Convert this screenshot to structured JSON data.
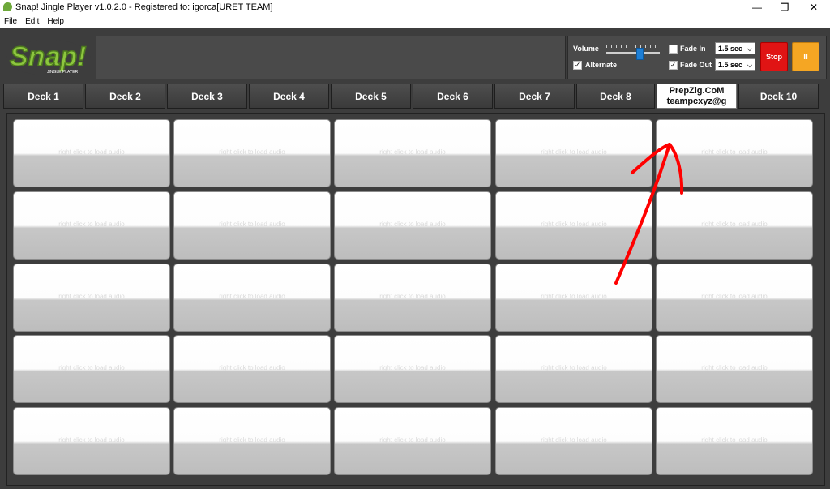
{
  "window": {
    "title": "Snap! Jingle Player v1.0.2.0 - Registered to: igorca[URET TEAM]",
    "controls": [
      "—",
      "❐",
      "✕"
    ]
  },
  "menu": [
    "File",
    "Edit",
    "Help"
  ],
  "logo": {
    "text": "Snap!",
    "subtext": "JINGLE PLAYER"
  },
  "controls": {
    "volume_label": "Volume",
    "volume_level": 0.6,
    "alternate_label": "Alternate",
    "alternate_checked": true,
    "fade_in_label": "Fade In",
    "fade_in_checked": false,
    "fade_in_value": "1.5 sec",
    "fade_out_label": "Fade Out",
    "fade_out_checked": true,
    "fade_out_value": "1.5 sec",
    "stop_label": "Stop",
    "pause_label": "II"
  },
  "decks": [
    "Deck 1",
    "Deck 2",
    "Deck 3",
    "Deck 4",
    "Deck 5",
    "Deck 6",
    "Deck 7",
    "Deck 8",
    "PrepZig.CoM teampcxyz@g",
    "Deck 10"
  ],
  "custom_deck": {
    "line1": "PrepZig.CoM",
    "line2": "teampcxyz@g"
  },
  "pad_placeholder": "right click to load audio",
  "pad_rows": 5,
  "pad_cols": 5,
  "colors": {
    "stop": "#e01414",
    "pause": "#f5a623",
    "annotation": "#ff0000",
    "logo": "#8dc63f"
  }
}
